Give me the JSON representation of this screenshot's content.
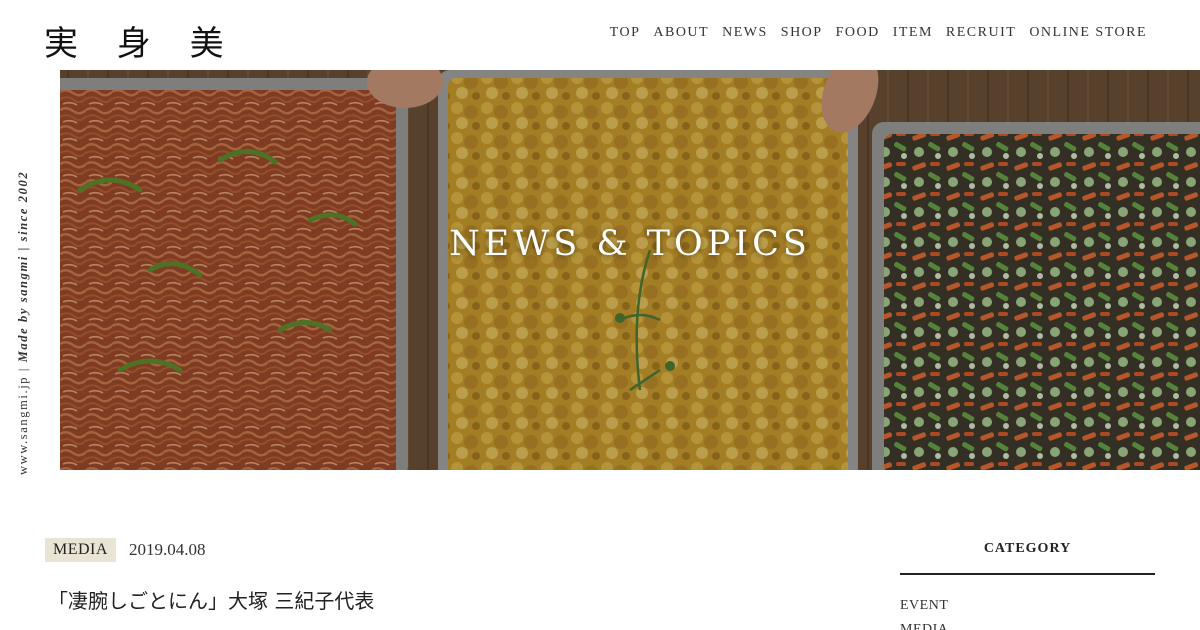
{
  "header": {
    "logo": "実 身 美",
    "nav": [
      "TOP",
      "ABOUT",
      "NEWS",
      "SHOP",
      "FOOD",
      "ITEM",
      "RECRUIT",
      "ONLINE STORE"
    ]
  },
  "side": {
    "url": "www.sangmi.jp",
    "separator": " | ",
    "made_by": "Made by sangmi",
    "since": "since 2002"
  },
  "hero": {
    "title": "NEWS & TOPICS",
    "image": "food-trays-photo"
  },
  "article": {
    "category": "MEDIA",
    "date": "2019.04.08",
    "title": "「凄腕しごとにん」大塚 三紀子代表"
  },
  "sidebar": {
    "heading": "CATEGORY",
    "items": [
      "EVENT",
      "MEDIA"
    ]
  },
  "colors": {
    "badge_bg": "#e9e4d4",
    "text": "#222222",
    "hero_text": "#ffffff"
  }
}
